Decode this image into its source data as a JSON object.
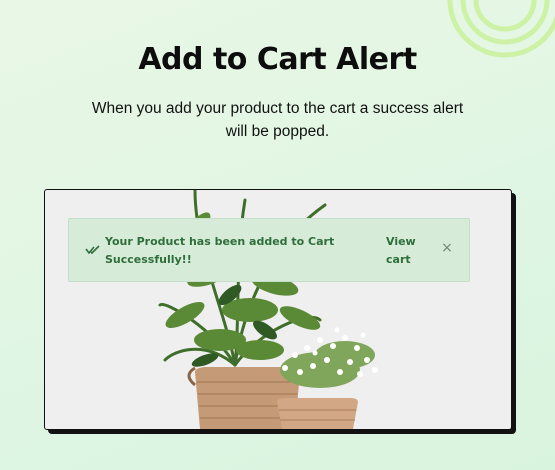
{
  "page": {
    "title": "Add to Cart Alert",
    "subtitle": "When you add your product to the cart a success alert will be popped."
  },
  "alert": {
    "message": "Your Product has been added to Cart Successfully!!",
    "action_label": "View cart",
    "close_symbol": "×",
    "icon": "double-check-icon"
  },
  "colors": {
    "alert_background": "#d6ecd9",
    "alert_text": "#2f6e3a",
    "frame_border": "#111111",
    "decor_rings": "#c9f0a0"
  }
}
